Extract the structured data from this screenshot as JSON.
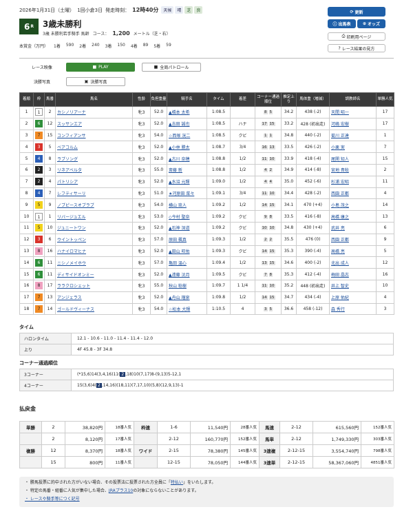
{
  "header": {
    "date": "2026年1月31日（土曜）",
    "meeting": "1回小倉3日",
    "start_label": "発走時刻：",
    "start_time": "12時40分",
    "weather_label": "天候",
    "weather": "晴",
    "track_label": "芝",
    "track_cond": "良"
  },
  "race": {
    "num": "6",
    "num_suffix": "R",
    "name": "3歳未勝利",
    "cond": "3歳  未勝利若手騎手  馬齢",
    "course_label": "コース：",
    "distance": "1,200",
    "course_suffix": "メートル（芝・右）"
  },
  "prize": {
    "label": "本賞金（万円）",
    "items": [
      {
        "rank": "1着",
        "amt": "590"
      },
      {
        "rank": "2着",
        "amt": "240"
      },
      {
        "rank": "3着",
        "amt": "150"
      },
      {
        "rank": "4着",
        "amt": "89"
      },
      {
        "rank": "5着",
        "amt": "59"
      }
    ]
  },
  "buttons": {
    "update": "更新",
    "entries": "出馬表",
    "odds": "オッズ",
    "print": "印刷用ページ",
    "guide": "レース結果の見方"
  },
  "tabs": {
    "video": "レース映像",
    "play": "PLAY",
    "patrol": "全周パトロール",
    "photo": "決勝写真",
    "photo_btn": "決勝写真"
  },
  "colors": {
    "accent": "#1e5fa8",
    "race_badge": "#1e4d20",
    "play": "#3a8a35"
  },
  "columns": [
    "着順",
    "枠",
    "馬番",
    "馬名",
    "性齢",
    "負担重量",
    "騎手名",
    "タイム",
    "着差",
    "コーナー通過順位",
    "推定上り",
    "馬体重（増減）",
    "調教師名",
    "単勝人気"
  ],
  "rows": [
    {
      "pos": "1",
      "waku": "1",
      "num": "2",
      "horse": "カシノリアーナ",
      "sex": "牝3",
      "wt": "52.0",
      "jockey": "▲橋本 太希",
      "time": "1:08.5",
      "margin": "",
      "c1": "8",
      "c2": "5",
      "last": "34.2",
      "bw": "438 (-2)",
      "trainer": "天間 昭一",
      "pop": "17"
    },
    {
      "pos": "2",
      "waku": "6",
      "num": "12",
      "horse": "スッサンエア",
      "sex": "牝3",
      "wt": "52.0",
      "jockey": "▲吉田 誠也",
      "time": "1:08.5",
      "margin": "ハナ",
      "c1": "17",
      "c2": "15",
      "last": "33.2",
      "bw": "428 (初出走)",
      "trainer": "河嶋 宏樹",
      "pop": "17"
    },
    {
      "pos": "3",
      "waku": "7",
      "num": "15",
      "horse": "コンフィアンサ",
      "sex": "牝3",
      "wt": "54.0",
      "jockey": "☆西塚 洸二",
      "time": "1:08.5",
      "margin": "クビ",
      "c1": "1",
      "c2": "1",
      "last": "34.8",
      "bw": "440 (-2)",
      "trainer": "菊川 正達",
      "pop": "1"
    },
    {
      "pos": "4",
      "waku": "3",
      "num": "5",
      "horse": "ベアコルム",
      "sex": "牝3",
      "wt": "52.0",
      "jockey": "▲小林 勝太",
      "time": "1:08.7",
      "margin": "3/4",
      "c1": "16",
      "c2": "13",
      "last": "33.5",
      "bw": "426 (-2)",
      "trainer": "小栗 実",
      "pop": "7"
    },
    {
      "pos": "5",
      "waku": "4",
      "num": "8",
      "horse": "ラブソング",
      "sex": "牝3",
      "wt": "52.0",
      "jockey": "▲古川 奈穂",
      "time": "1:08.8",
      "margin": "1/2",
      "c1": "11",
      "c2": "10",
      "last": "33.9",
      "bw": "418 (-4)",
      "trainer": "尾関 知人",
      "pop": "15"
    },
    {
      "pos": "6",
      "waku": "2",
      "num": "3",
      "horse": "リネアベルタ",
      "sex": "牝3",
      "wt": "55.0",
      "jockey": "斎藤 新",
      "time": "1:08.8",
      "margin": "1/2",
      "c1": "4",
      "c2": "2",
      "last": "34.9",
      "bw": "414 (-8)",
      "trainer": "宮地 貴稔",
      "pop": "2"
    },
    {
      "pos": "7",
      "waku": "2",
      "num": "4",
      "horse": "パトリシア",
      "sex": "牝3",
      "wt": "52.0",
      "jockey": "▲水沼 元輝",
      "time": "1:09.0",
      "margin": "1/2",
      "c1": "4",
      "c2": "4",
      "last": "35.0",
      "bw": "452 (-6)",
      "trainer": "杉浦 宏昭",
      "pop": "11"
    },
    {
      "pos": "8",
      "waku": "4",
      "num": "7",
      "horse": "レフティサーリ",
      "sex": "牝3",
      "wt": "51.0",
      "jockey": "★河原田 菜々",
      "time": "1:09.1",
      "margin": "3/4",
      "c1": "11",
      "c2": "10",
      "last": "34.4",
      "bw": "428 (-2)",
      "trainer": "西園 正都",
      "pop": "4"
    },
    {
      "pos": "9",
      "waku": "5",
      "num": "9",
      "horse": "ノブピースオブラブ",
      "sex": "牝3",
      "wt": "54.0",
      "jockey": "横山 琉人",
      "time": "1:09.2",
      "margin": "1/2",
      "c1": "14",
      "c2": "15",
      "last": "34.1",
      "bw": "470 (+4)",
      "trainer": "小島 茂之",
      "pop": "14"
    },
    {
      "pos": "10",
      "waku": "1",
      "num": "1",
      "horse": "リバージュエル",
      "sex": "牝3",
      "wt": "53.0",
      "jockey": "◇今村 聖奈",
      "time": "1:09.2",
      "margin": "クビ",
      "c1": "9",
      "c2": "8",
      "last": "33.5",
      "bw": "416 (-8)",
      "trainer": "高橋 康之",
      "pop": "13"
    },
    {
      "pos": "11",
      "waku": "5",
      "num": "10",
      "horse": "ジュニートワン",
      "sex": "牝3",
      "wt": "52.0",
      "jockey": "▲石神 深道",
      "time": "1:09.2",
      "margin": "クビ",
      "c1": "10",
      "c2": "10",
      "last": "34.8",
      "bw": "430 (+4)",
      "trainer": "武井 亮",
      "pop": "6"
    },
    {
      "pos": "12",
      "waku": "3",
      "num": "6",
      "horse": "ウイントッペン",
      "sex": "牝3",
      "wt": "57.0",
      "jockey": "原田 楓真",
      "time": "1:09.3",
      "margin": "1/2",
      "c1": "2",
      "c2": "2",
      "last": "35.5",
      "bw": "476 (0)",
      "trainer": "西園 正都",
      "pop": "9"
    },
    {
      "pos": "13",
      "waku": "8",
      "num": "16",
      "horse": "ハナイロマヒナ",
      "sex": "牝3",
      "wt": "52.0",
      "jockey": "▲田山 旺佑",
      "time": "1:09.3",
      "margin": "クビ",
      "c1": "14",
      "c2": "15",
      "last": "35.3",
      "bw": "390 (-4)",
      "trainer": "高橋 亮",
      "pop": "5"
    },
    {
      "pos": "14",
      "waku": "6",
      "num": "11",
      "horse": "ニシノメイホウ",
      "sex": "牝3",
      "wt": "57.0",
      "jockey": "亀田 温心",
      "time": "1:09.4",
      "margin": "1/2",
      "c1": "13",
      "c2": "15",
      "last": "34.6",
      "bw": "400 (-2)",
      "trainer": "北出 成人",
      "pop": "12"
    },
    {
      "pos": "15",
      "waku": "6",
      "num": "11",
      "horse": "ディサイドオンミー",
      "sex": "牝3",
      "wt": "52.0",
      "jockey": "▲遠藤 汰月",
      "time": "1:09.5",
      "margin": "クビ",
      "c1": "7",
      "c2": "8",
      "last": "35.3",
      "bw": "412 (-4)",
      "trainer": "梅田 晶志",
      "pop": "16"
    },
    {
      "pos": "16",
      "waku": "8",
      "num": "17",
      "horse": "ララクロシェット",
      "sex": "牝3",
      "wt": "55.0",
      "jockey": "秋山 稔樹",
      "time": "1:09.7",
      "margin": "1 1/4",
      "c1": "11",
      "c2": "10",
      "last": "35.2",
      "bw": "448 (初出走)",
      "trainer": "井上 智史",
      "pop": "10"
    },
    {
      "pos": "17",
      "waku": "7",
      "num": "13",
      "horse": "アンジェラス",
      "sex": "牝3",
      "wt": "52.0",
      "jockey": "▲舟山 瑠泉",
      "time": "1:09.8",
      "margin": "1/2",
      "c1": "14",
      "c2": "15",
      "last": "34.7",
      "bw": "434 (-4)",
      "trainer": "上原 佑紀",
      "pop": "4"
    },
    {
      "pos": "18",
      "waku": "7",
      "num": "14",
      "horse": "ゴールドヴィーナス",
      "sex": "牝3",
      "wt": "54.0",
      "jockey": "☆松本 大輝",
      "time": "1:10.5",
      "margin": "4",
      "c1": "3",
      "c2": "5",
      "last": "36.6",
      "bw": "458 (-12)",
      "trainer": "森 秀行",
      "pop": "3"
    }
  ],
  "times": {
    "title": "タイム",
    "halon_label": "ハロンタイム",
    "halon": "12.1 - 10.6 - 11.0 - 11.4 - 11.4 - 12.0",
    "agari_label": "上り",
    "agari": "4F 45.8 - 3F 34.8"
  },
  "corner": {
    "title": "コーナー通過順位",
    "c3_label": "3コーナー",
    "c3_pre": "(*15,6)14(3,4,16)11(",
    "c3_hl": "2",
    "c3_post": ",18)10(7,17)8-(9,13)5-12,1",
    "c4_label": "4コーナー",
    "c4_pre": "15(3,6)4(",
    "c4_hl": "2",
    "c4_post": ",14,16)(18,11)(7,17,10)(5,8)(12,9,13)-1"
  },
  "payout": {
    "title": "払戻金",
    "left": [
      {
        "type": "単勝",
        "num": "2",
        "amt": "38,820円",
        "pop": "18番人気"
      },
      {
        "type": "",
        "num": "2",
        "amt": "8,120円",
        "pop": "17番人気"
      },
      {
        "type": "複勝",
        "num": "12",
        "amt": "8,370円",
        "pop": "18番人気"
      },
      {
        "type": "",
        "num": "15",
        "amt": "800円",
        "pop": "11番人気"
      }
    ],
    "mid": [
      {
        "type": "枠連",
        "num": "1-6",
        "amt": "11,540円",
        "pop": "28番人気"
      },
      {
        "type": "",
        "num": "2-12",
        "amt": "160,770円",
        "pop": "152番人気"
      },
      {
        "type": "ワイド",
        "num": "2-15",
        "amt": "78,380円",
        "pop": "145番人気"
      },
      {
        "type": "",
        "num": "12-15",
        "amt": "78,050円",
        "pop": "144番人気"
      }
    ],
    "right": [
      {
        "type": "馬連",
        "num": "2-12",
        "amt": "615,560円",
        "pop": "152番人気"
      },
      {
        "type": "馬単",
        "num": "2-12",
        "amt": "1,749,330円",
        "pop": "303番人気"
      },
      {
        "type": "3連複",
        "num": "2-12-15",
        "amt": "3,554,740円",
        "pop": "798番人気"
      },
      {
        "type": "3連単",
        "num": "2-12-15",
        "amt": "58,367,060円",
        "pop": "4851番人気"
      }
    ]
  },
  "notes": {
    "n1_pre": "・ 勝馬投票に的中された方がいない場合、その投票法に投票された方全員に「",
    "n1_link": "特払い",
    "n1_post": "」をいたします。",
    "n2_pre": "・ 特定の馬番・組番に人気が集中した場合、",
    "n2_link": "JRAプラス10",
    "n2_post": "の対象にならないことがあります。",
    "n3": "・ レースや騎手等につく記号"
  }
}
